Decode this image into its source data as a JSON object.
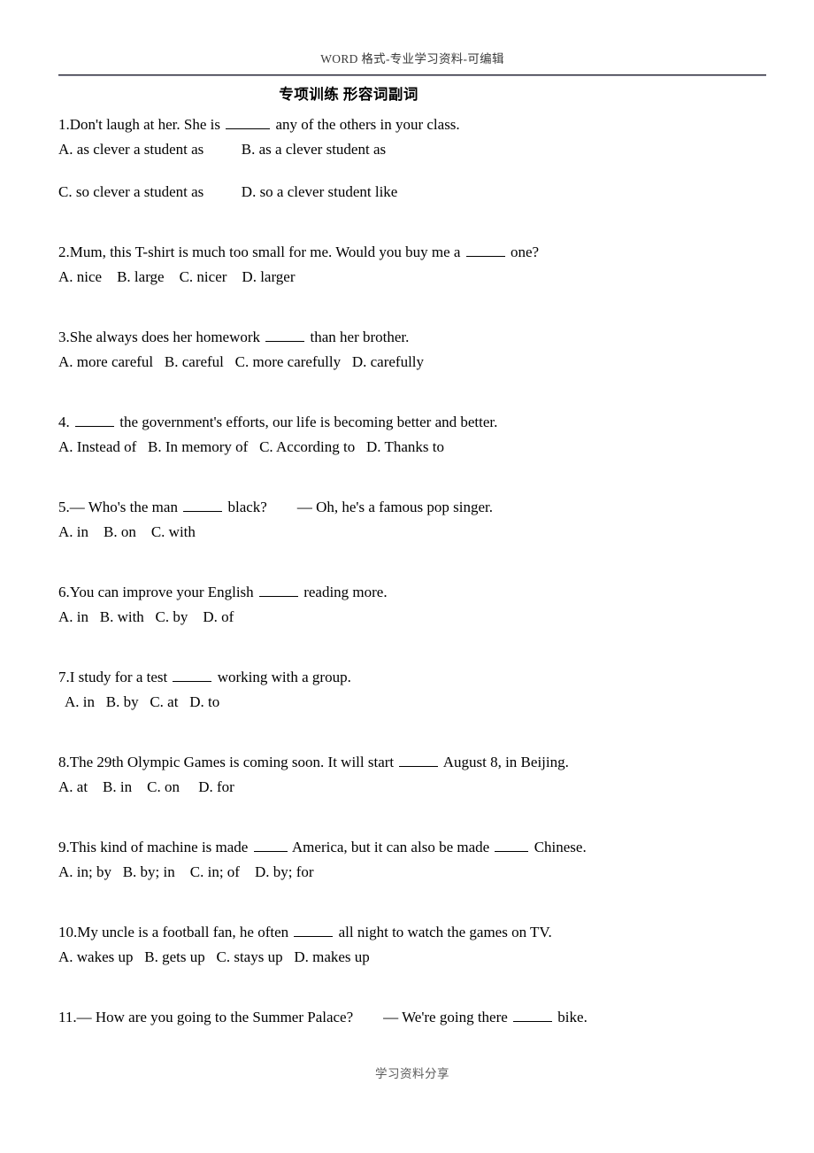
{
  "header": {
    "text": "WORD 格式-专业学习资料-可编辑"
  },
  "title": "专项训练 形容词副词",
  "footer": {
    "text": "学习资料分享"
  },
  "questions": [
    {
      "number": "1.",
      "stem_before": "1.Don't laugh at her. She is ",
      "stem_after": " any of the others in your class.",
      "options_line1": "A. as clever a student as          B. as a clever student as",
      "options_line2": "C. so clever a student as          D. so a clever student like"
    },
    {
      "number": "2.",
      "stem_before": "2.Mum, this T-shirt is much too small for me. Would you buy me a ",
      "stem_after": " one?",
      "options": "A. nice    B. large    C. nicer    D. larger"
    },
    {
      "number": "3.",
      "stem_before": "3.She always does her homework ",
      "stem_after": " than her brother.",
      "options": "A. more careful   B. careful   C. more carefully   D. carefully"
    },
    {
      "number": "4.",
      "stem_before": "4. ",
      "stem_after": " the government's efforts, our life is becoming better and better.",
      "options": "A. Instead of   B. In memory of   C. According to   D. Thanks to"
    },
    {
      "number": "5.",
      "stem_before": "5.— Who's the man ",
      "stem_mid": " black?",
      "stem_after": "— Oh, he's a famous pop singer.",
      "options": "A. in    B. on    C. with"
    },
    {
      "number": "6.",
      "stem_before": "6.You can improve your English ",
      "stem_after": " reading more.",
      "options": "A. in   B. with   C. by    D. of"
    },
    {
      "number": "7.",
      "stem_before": "7.I study for a test ",
      "stem_after": " working with a group.",
      "options": "A. in   B. by   C. at   D. to"
    },
    {
      "number": "8.",
      "stem_before": "8.The 29th Olympic Games is coming soon. It will start ",
      "stem_after": " August 8, in Beijing.",
      "options": "A. at    B. in    C. on     D. for"
    },
    {
      "number": "9.",
      "stem_before": "9.This kind of machine is made ",
      "stem_mid": " America, but it can also be made ",
      "stem_after": " Chinese.",
      "options": "A. in; by   B. by; in    C. in; of    D. by; for"
    },
    {
      "number": "10.",
      "stem_before": "10.My uncle is a football fan, he often ",
      "stem_after": " all night to watch the games on TV.",
      "options": "A. wakes up   B. gets up   C. stays up   D. makes up"
    },
    {
      "number": "11.",
      "stem_before": "11.— How are you going to the Summer Palace?",
      "stem_mid": "— We're going there ",
      "stem_after": " bike."
    }
  ]
}
